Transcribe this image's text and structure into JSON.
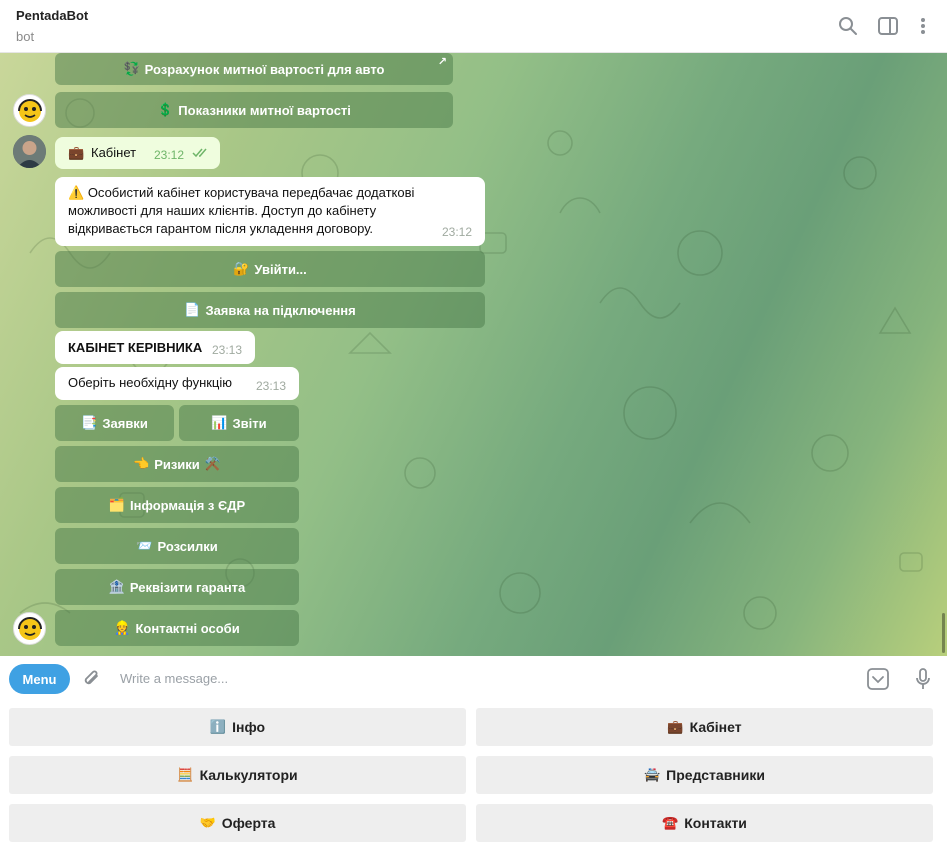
{
  "header": {
    "title": "PentadaBot",
    "subtitle": "bot"
  },
  "messages": {
    "btn_customs_calc": {
      "icon": "💱",
      "label": "Розрахунок митної вартості для авто"
    },
    "btn_customs_indicators": {
      "icon": "💲",
      "label": "Показники митної вартості"
    },
    "out_cabinet": {
      "icon": "💼",
      "text": "Кабінет",
      "time": "23:12"
    },
    "warning": {
      "icon": "⚠️",
      "line1": "Особистий кабінет користувача передбачає додаткові",
      "line2": "можливості для наших клієнтів. Доступ до кабінету",
      "line3": "відкривається гарантом після укладення договору.",
      "time": "23:12"
    },
    "btn_login": {
      "icon": "🔐",
      "label": "Увійти..."
    },
    "btn_request": {
      "icon": "📄",
      "label": "Заявка на підключення"
    },
    "manager_title": {
      "text": "КАБІНЕТ КЕРІВНИКА",
      "time": "23:13"
    },
    "choose_function": {
      "text": "Оберіть необхідну функцію",
      "time": "23:13"
    },
    "btn_applications": {
      "icon": "📑",
      "label": "Заявки"
    },
    "btn_reports": {
      "icon": "📊",
      "label": "Звіти"
    },
    "btn_risks": {
      "icon": "👈",
      "label": "Ризики",
      "icon2": "⚒️"
    },
    "btn_edr": {
      "icon": "🗂️",
      "label": "Інформація з ЄДР"
    },
    "btn_mailings": {
      "icon": "📨",
      "label": "Розсилки"
    },
    "btn_requisites": {
      "icon": "🏦",
      "label": "Реквізити гаранта"
    },
    "btn_contacts": {
      "icon": "👷",
      "label": "Контактні особи"
    }
  },
  "composer": {
    "menu_label": "Menu",
    "placeholder": "Write a message..."
  },
  "keyboard": {
    "info": {
      "icon": "ℹ️",
      "label": "Інфо"
    },
    "cabinet": {
      "icon": "💼",
      "label": "Кабінет"
    },
    "calculators": {
      "icon": "🧮",
      "label": "Калькулятори"
    },
    "representatives": {
      "icon": "🚔",
      "label": "Представники"
    },
    "offer": {
      "icon": "🤝",
      "label": "Оферта"
    },
    "contacts": {
      "icon": "☎️",
      "label": "Контакти"
    }
  },
  "colors": {
    "accent": "#3fa1e3",
    "inline_button": "#4f8552",
    "outgoing_bubble": "#effdde",
    "check": "#6fb569"
  },
  "icons": [
    "search-icon",
    "sidebar-toggle-icon",
    "more-vertical-icon",
    "attach-icon",
    "bot-commands-icon",
    "microphone-icon",
    "read-checks-icon"
  ]
}
